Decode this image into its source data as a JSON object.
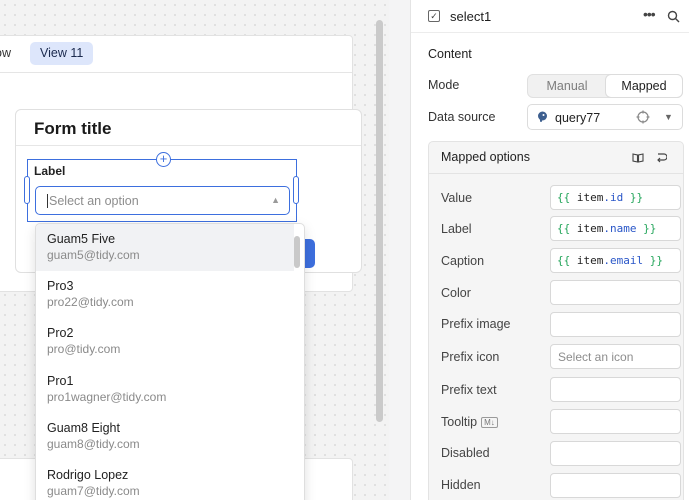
{
  "canvas": {
    "tabs": {
      "prev_label": "ow",
      "active_label": "View 11"
    },
    "form": {
      "title": "Form title",
      "field_label": "Label",
      "select_placeholder": "Select an option"
    },
    "dropdown_options": [
      {
        "name": "Guam5 Five",
        "email": "guam5@tidy.com"
      },
      {
        "name": "Pro3",
        "email": "pro22@tidy.com"
      },
      {
        "name": "Pro2",
        "email": "pro@tidy.com"
      },
      {
        "name": "Pro1",
        "email": "pro1wagner@tidy.com"
      },
      {
        "name": "Guam8 Eight",
        "email": "guam8@tidy.com"
      },
      {
        "name": "Rodrigo Lopez",
        "email": "guam7@tidy.com"
      }
    ]
  },
  "inspector": {
    "component_name": "select1",
    "section_title": "Content",
    "mode": {
      "label": "Mode",
      "options": [
        "Manual",
        "Mapped"
      ],
      "selected": "Mapped"
    },
    "data_source": {
      "label": "Data source",
      "value": "query77"
    },
    "mapped_options": {
      "title": "Mapped options",
      "rows": [
        {
          "label": "Value",
          "code": {
            "open": "{{",
            "ident": "item",
            "prop": ".id",
            "close": "}}"
          }
        },
        {
          "label": "Label",
          "code": {
            "open": "{{",
            "ident": "item",
            "prop": ".name",
            "close": "}}"
          }
        },
        {
          "label": "Caption",
          "code": {
            "open": "{{",
            "ident": "item",
            "prop": ".email",
            "close": "}}"
          }
        },
        {
          "label": "Color"
        },
        {
          "label": "Prefix image"
        },
        {
          "label": "Prefix icon",
          "placeholder": "Select an icon"
        },
        {
          "label": "Prefix text"
        },
        {
          "label": "Tooltip",
          "badge": "M↓"
        },
        {
          "label": "Disabled"
        },
        {
          "label": "Hidden"
        }
      ]
    }
  },
  "colors": {
    "accent": "#3d6fde",
    "tab_active_bg": "#dde6fb",
    "code_brace": "#23a55a",
    "code_prop": "#2956c8"
  }
}
